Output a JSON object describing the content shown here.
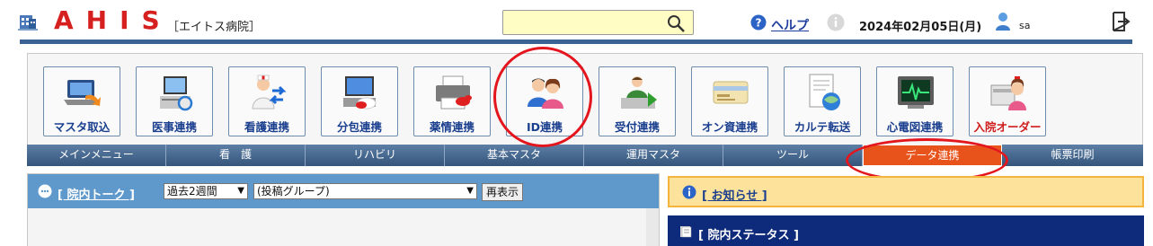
{
  "app": {
    "logo": "AHIS",
    "hospital": "［エイトス病院］"
  },
  "header": {
    "search_value": "",
    "help_label": "ヘルプ",
    "date": "2024年02月05日(月)",
    "user": "sa"
  },
  "menu_tiles": [
    {
      "label": "マスタ取込",
      "icon": "laptop-import-icon"
    },
    {
      "label": "医事連携",
      "icon": "computer-sync-icon"
    },
    {
      "label": "看護連携",
      "icon": "nurse-transfer-icon"
    },
    {
      "label": "分包連携",
      "icon": "pill-packaging-icon"
    },
    {
      "label": "薬情連携",
      "icon": "printer-drug-info-icon"
    },
    {
      "label": "ID連携",
      "icon": "people-id-icon"
    },
    {
      "label": "受付連携",
      "icon": "reception-icon"
    },
    {
      "label": "オン資連携",
      "icon": "card-reader-icon"
    },
    {
      "label": "カルテ転送",
      "icon": "chart-transfer-icon"
    },
    {
      "label": "心電図連携",
      "icon": "ecg-monitor-icon"
    },
    {
      "label": "入院オーダー",
      "icon": "admission-bed-icon"
    }
  ],
  "tabs": [
    "メインメニュー",
    "看　護",
    "リハビリ",
    "基本マスタ",
    "運用マスタ",
    "ツール",
    "データ連携",
    "帳票印刷"
  ],
  "active_tab": "データ連携",
  "talk": {
    "title": "[ 院内トーク ]",
    "period": "過去2週間",
    "group": "(投稿グループ)",
    "redisplay": "再表示"
  },
  "notice": {
    "title": "[ お知らせ ]"
  },
  "status": {
    "title": "[ 院内ステータス ]"
  },
  "colors": {
    "brand_red": "#d62020",
    "tab_bar": "#3a5a7e",
    "active_tab": "#e8531b",
    "talk_header": "#5f99cc",
    "notice_bg": "#fde29b",
    "status_bg": "#0e2a7a",
    "annotation_red": "#e3161d"
  }
}
